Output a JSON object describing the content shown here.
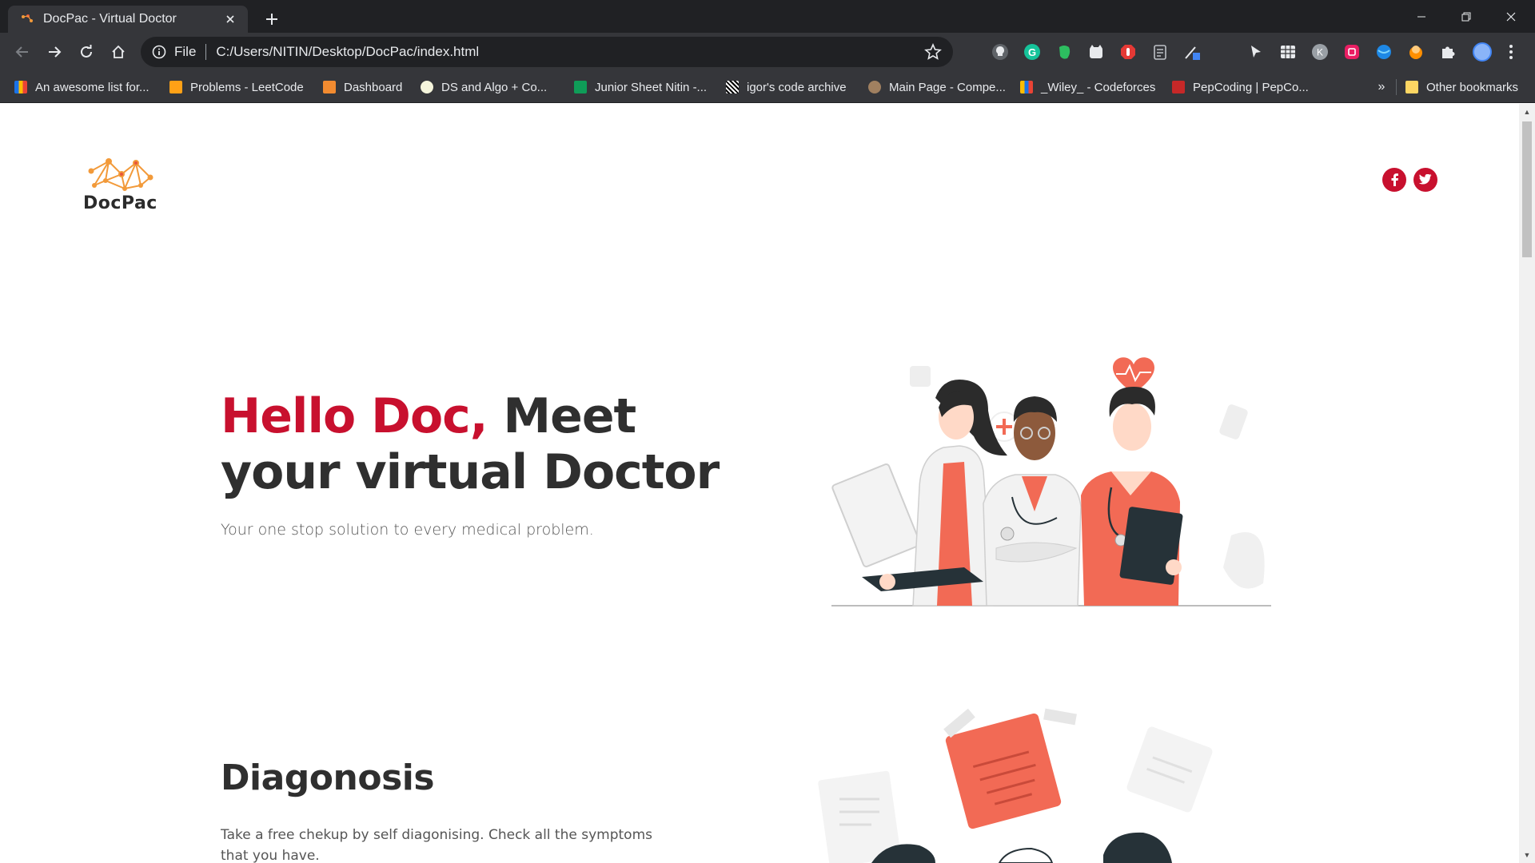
{
  "browser": {
    "tab": {
      "title": "DocPac - Virtual Doctor"
    },
    "address": {
      "scheme": "File",
      "url": "C:/Users/NITIN/Desktop/DocPac/index.html"
    },
    "bookmarks": [
      {
        "label": "An awesome list for..."
      },
      {
        "label": "Problems - LeetCode"
      },
      {
        "label": "Dashboard"
      },
      {
        "label": "DS and Algo + Co..."
      },
      {
        "label": "Junior Sheet Nitin -..."
      },
      {
        "label": "igor's code archive"
      },
      {
        "label": "Main Page - Compe..."
      },
      {
        "label": "_Wiley_ - Codeforces"
      },
      {
        "label": "PepCoding | PepCo..."
      }
    ],
    "bookmarks_more": "»",
    "other_bookmarks": "Other bookmarks",
    "extension_icons": [
      "lightbulb-icon",
      "grammarly-icon",
      "evernote-icon",
      "cat-extension-icon",
      "adblock-icon",
      "clipboard-icon",
      "pen-icon",
      "cursor-icon",
      "grid-icon",
      "k-extension-icon",
      "record-icon",
      "globe-icon",
      "honey-icon",
      "puzzle-icon"
    ]
  },
  "site": {
    "logo_text": "DocPac",
    "social": [
      "facebook-icon",
      "twitter-icon"
    ],
    "hero": {
      "title_accent": "Hello Doc,",
      "title_rest": " Meet your virtual Doctor",
      "subtitle": "Your one stop solution to every medical problem."
    },
    "diagnosis": {
      "title": "Diagonosis",
      "text": "Take a free chekup by self diagonising. Check all the symptoms that you have."
    }
  },
  "colors": {
    "accent": "#c8102e",
    "coral": "#f26a55",
    "chrome_dark": "#202124",
    "chrome": "#35363a"
  }
}
